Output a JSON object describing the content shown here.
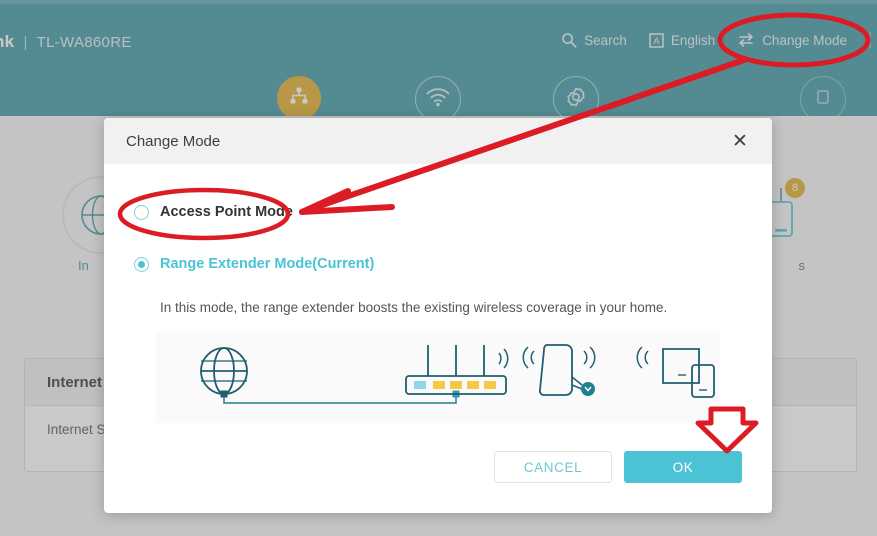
{
  "header": {
    "logo_text": "nk",
    "separator": "|",
    "model": "TL-WA860RE",
    "tools": [
      {
        "label": "Search",
        "icon": "search-icon"
      },
      {
        "label": "English",
        "icon": "language-icon"
      },
      {
        "label": "Change Mode",
        "icon": "swap-arrows-icon"
      }
    ]
  },
  "nav": {
    "items": [
      {
        "icon": "network-topology-icon",
        "state": "active"
      },
      {
        "icon": "wifi-icon",
        "state": "inactive"
      },
      {
        "icon": "gear-icon",
        "state": "inactive"
      },
      {
        "icon": "partial-icon",
        "state": "inactive"
      }
    ]
  },
  "background": {
    "globe_label": "In",
    "client_label": "s",
    "client_badge": "8",
    "panel_title": "Internet",
    "panel_row": "Internet S"
  },
  "dialog": {
    "title": "Change Mode",
    "close_icon": "✕",
    "options": [
      {
        "label": "Access Point Mode",
        "selected": false
      },
      {
        "label": "Range Extender Mode(Current)",
        "selected": true
      }
    ],
    "description": "In this mode, the range extender boosts the existing wireless coverage in your home.",
    "diagram": {
      "nodes": [
        "globe-icon",
        "router-icon",
        "range-extender-icon",
        "client-devices-icon"
      ],
      "router_ports": [
        "wan",
        "lan",
        "lan",
        "lan",
        "lan"
      ],
      "router_antennas": 3
    },
    "buttons": {
      "cancel": "CANCEL",
      "ok": "OK"
    }
  },
  "annotations": {
    "accent_color": "#dc1c24",
    "marks": [
      {
        "type": "ellipse",
        "target": "change-mode-menu"
      },
      {
        "type": "arrow",
        "from": "change-mode-menu",
        "to": "access-point-mode-option"
      },
      {
        "type": "ellipse",
        "target": "access-point-mode-option"
      },
      {
        "type": "down-arrow",
        "target": "ok-button"
      }
    ]
  },
  "colors": {
    "header_teal": "#3d98a4",
    "accent_teal": "#4cc3d4",
    "nav_active": "#e3ae26",
    "annotation_red": "#dc1c24"
  }
}
